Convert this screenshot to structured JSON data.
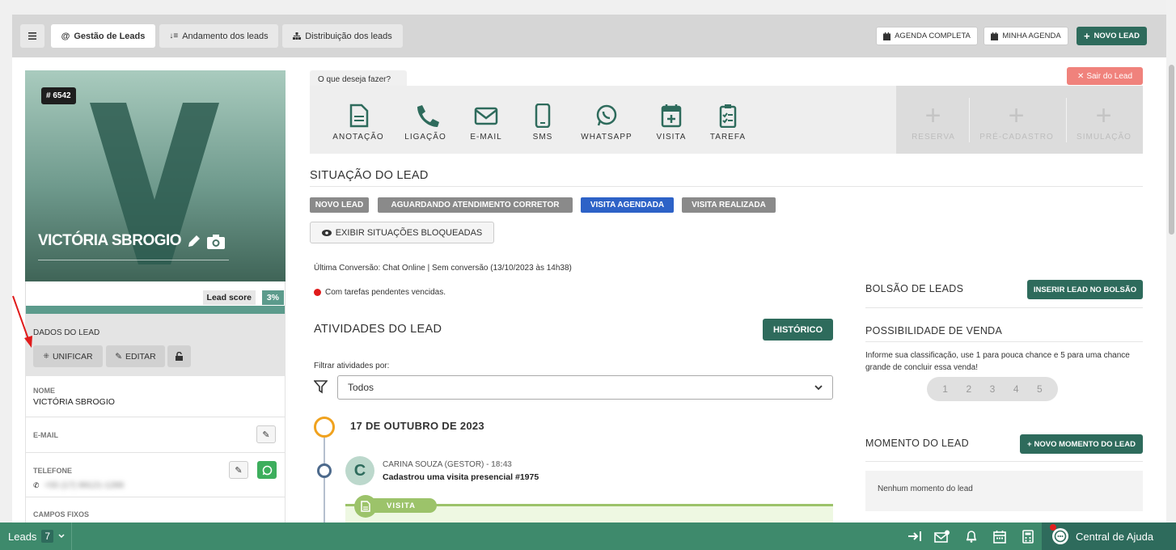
{
  "topbar": {
    "menu_icon": "hamburger-icon",
    "tabs": [
      {
        "label": "Gestão de Leads",
        "icon": "at-icon"
      },
      {
        "label": "Andamento dos leads",
        "icon": "sort-icon"
      },
      {
        "label": "Distribuição dos leads",
        "icon": "sitemap-icon"
      }
    ],
    "agenda_completa": "AGENDA COMPLETA",
    "minha_agenda": "MINHA AGENDA",
    "novo_lead": "NOVO LEAD"
  },
  "lead": {
    "id": "# 6542",
    "initial": "V",
    "name": "VICTÓRIA SBROGIO",
    "score_label": "Lead score",
    "score_value": "3%"
  },
  "dados": {
    "title": "DADOS DO LEAD",
    "unificar": "UNIFICAR",
    "editar": "EDITAR"
  },
  "fields": {
    "nome_label": "NOME",
    "nome_value": "VICTÓRIA SBROGIO",
    "email_label": "E-MAIL",
    "telefone_label": "TELEFONE",
    "telefone_value": "+55 (17) 99121-1289",
    "campos_label": "CAMPOS FIXOS"
  },
  "actions": {
    "prompt": "O que deseja fazer?",
    "items": [
      {
        "label": "ANOTAÇÃO",
        "icon": "file-icon"
      },
      {
        "label": "LIGAÇÃO",
        "icon": "phone-icon"
      },
      {
        "label": "E-MAIL",
        "icon": "envelope-icon"
      },
      {
        "label": "SMS",
        "icon": "mobile-icon"
      },
      {
        "label": "WHATSAPP",
        "icon": "whatsapp-icon"
      },
      {
        "label": "VISITA",
        "icon": "calendar-plus-icon"
      },
      {
        "label": "TAREFA",
        "icon": "clipboard-icon"
      }
    ],
    "disabled": [
      "RESERVA",
      "PRÉ-CADASTRO",
      "SIMULAÇÃO"
    ],
    "sair": "Sair do Lead"
  },
  "situacao": {
    "title": "SITUAÇÃO DO LEAD",
    "tags": [
      {
        "label": "NOVO LEAD",
        "active": false
      },
      {
        "label": "AGUARDANDO ATENDIMENTO CORRETOR",
        "active": false
      },
      {
        "label": "VISITA AGENDADA",
        "active": true
      },
      {
        "label": "VISITA REALIZADA",
        "active": false
      }
    ],
    "exibir": "EXIBIR SITUAÇÕES BLOQUEADAS"
  },
  "conversao": "Última Conversão: Chat Online | Sem conversão (13/10/2023 às 14h38)",
  "pendentes": "Com tarefas pendentes vencidas.",
  "atividades": {
    "title": "ATIVIDADES DO LEAD",
    "historico": "HISTÓRICO",
    "filter_label": "Filtrar atividades por:",
    "filter_value": "Todos",
    "date": "17 DE OUTUBRO DE 2023",
    "entry_author": "CARINA SOUZA (GESTOR) -",
    "entry_time": "18:43",
    "entry_text": "Cadastrou uma visita presencial #1975",
    "entry_initial": "C",
    "entry_type": "VISITA"
  },
  "bolsao": {
    "title": "BOLSÃO DE LEADS",
    "button": "INSERIR LEAD NO BOLSÃO"
  },
  "possibilidade": {
    "title": "POSSIBILIDADE DE VENDA",
    "text": "Informe sua classificação, use 1 para pouca chance e 5 para uma chance grande de concluir essa venda!",
    "ratings": [
      "1",
      "2",
      "3",
      "4",
      "5"
    ]
  },
  "momento": {
    "title": "MOMENTO DO LEAD",
    "button": "NOVO MOMENTO DO LEAD",
    "empty": "Nenhum momento do lead"
  },
  "bottombar": {
    "leads_label": "Leads",
    "leads_count": "7",
    "help": "Central de Ajuda"
  },
  "colors": {
    "brand_green": "#2e6b5c",
    "bar_green": "#3e8a6c",
    "active_tag": "#2d62c7",
    "sair": "#f0827c"
  }
}
